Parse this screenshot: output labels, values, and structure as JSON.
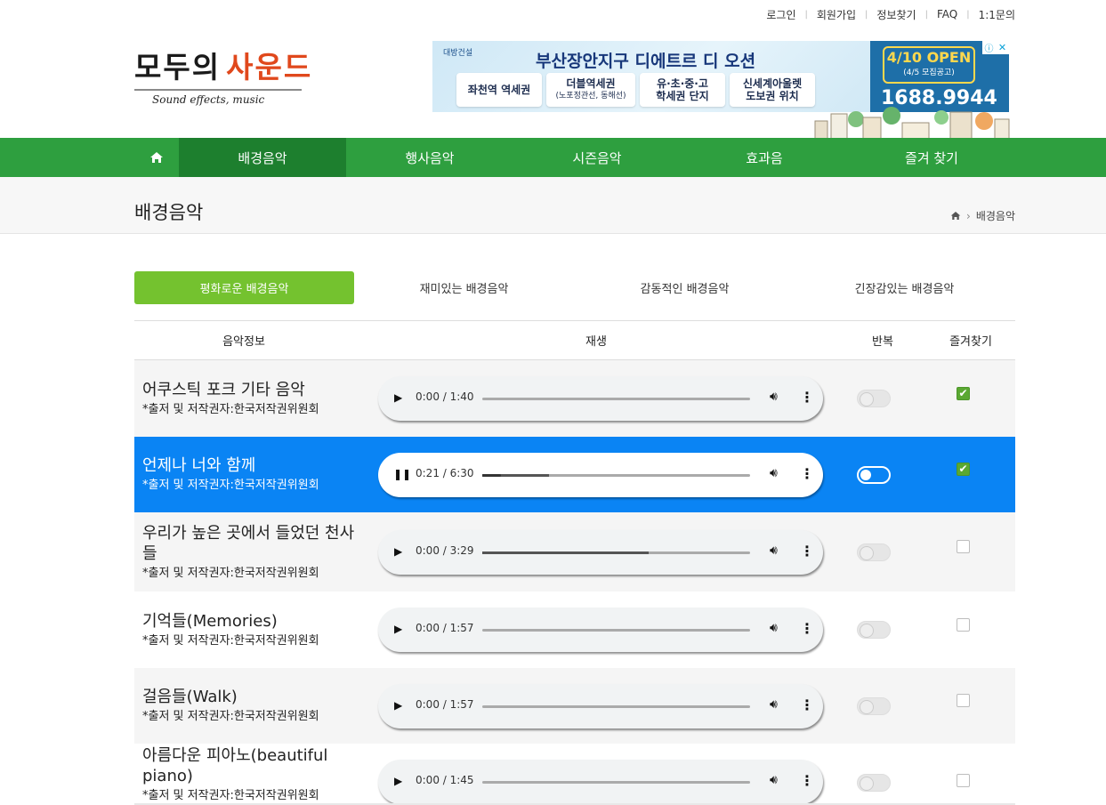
{
  "top_links": [
    "로그인",
    "회원가입",
    "정보찾기",
    "FAQ",
    "1:1문의"
  ],
  "logo": {
    "part1": "모두의",
    "part2": "사운드",
    "tagline": "Sound effects, music"
  },
  "ad": {
    "brand": "대방건설",
    "headline": "부산장안지구 디에트르 디 오션",
    "chips": [
      {
        "line1": "좌천역 역세권",
        "line2": ""
      },
      {
        "line1": "더블역세권",
        "line2": "(노포정관선, 동해선)"
      },
      {
        "line1": "유·초·중·고",
        "line2": "학세권 단지"
      },
      {
        "line1": "신세계아울렛",
        "line2": "도보권 위치"
      }
    ],
    "open": "4/10 OPEN",
    "open_sub": "(4/5 모집공고)",
    "phone": "1688.9944"
  },
  "nav": {
    "home_icon": "home-icon",
    "items": [
      "배경음악",
      "행사음악",
      "시즌음악",
      "효과음",
      "즐겨 찾기"
    ],
    "active_index": 0
  },
  "page": {
    "title": "배경음악",
    "breadcrumb_current": "배경음악"
  },
  "tabs": [
    "평화로운 배경음악",
    "재미있는 배경음악",
    "감동적인 배경음악",
    "긴장감있는 배경음악"
  ],
  "table": {
    "headers": {
      "info": "음악정보",
      "play": "재생",
      "repeat": "반복",
      "favorite": "즐겨찾기"
    },
    "rows": [
      {
        "title": "어쿠스틱 포크 기타 음악",
        "credit": "*출저 및 저작권자:한국저작권위원회",
        "time": "0:00 / 1:40",
        "playing": false,
        "progress": 0,
        "buffered": 0,
        "repeat": false,
        "favorite": true
      },
      {
        "title": "언제나 너와 함께",
        "credit": "*출저 및 저작권자:한국저작권위원회",
        "time": "0:21 / 6:30",
        "playing": true,
        "progress": 0.07,
        "buffered": 0.25,
        "repeat": false,
        "favorite": true
      },
      {
        "title": "우리가 높은 곳에서 들었던 천사들",
        "credit": "*출저 및 저작권자:한국저작권위원회",
        "time": "0:00 / 3:29",
        "playing": false,
        "progress": 0,
        "buffered": 0.62,
        "repeat": false,
        "favorite": false
      },
      {
        "title": "기억들(Memories)",
        "credit": "*출저 및 저작권자:한국저작권위원회",
        "time": "0:00 / 1:57",
        "playing": false,
        "progress": 0,
        "buffered": 0,
        "repeat": false,
        "favorite": false
      },
      {
        "title": "걸음들(Walk)",
        "credit": "*출저 및 저작권자:한국저작권위원회",
        "time": "0:00 / 1:57",
        "playing": false,
        "progress": 0,
        "buffered": 0,
        "repeat": false,
        "favorite": false
      },
      {
        "title": "아름다운 피아노(beautiful piano)",
        "credit": "*출저 및 저작권자:한국저작권위원회",
        "time": "0:00 / 1:45",
        "playing": false,
        "progress": 0,
        "buffered": 0,
        "repeat": false,
        "favorite": false
      }
    ]
  },
  "colors": {
    "nav_green": "#2e9f3f",
    "nav_active": "#1d7f2e",
    "tab_active": "#74c22f",
    "row_active": "#0a84f4",
    "logo_accent": "#e0481c"
  }
}
